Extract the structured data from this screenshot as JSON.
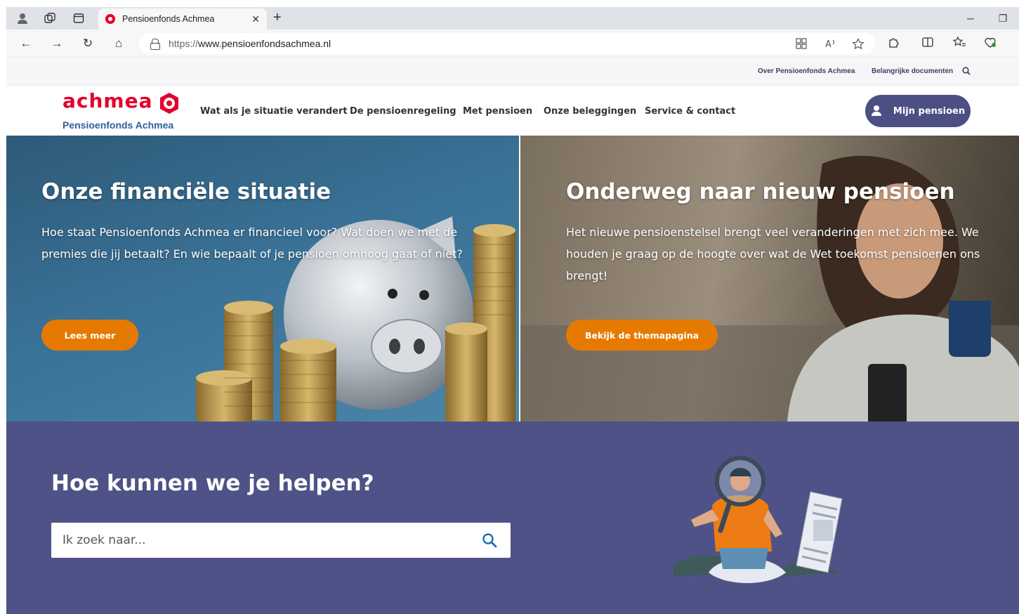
{
  "browser": {
    "tab_title": "Pensioenfonds Achmea",
    "tab_close": "✕",
    "new_tab": "+",
    "url_scheme": "https://",
    "url_host": "www.pensioenfondsachmea.nl",
    "win_minimize": "─",
    "win_restore": "❐",
    "nav_back": "←",
    "nav_forward": "→",
    "nav_reload": "↻",
    "nav_home": "⌂"
  },
  "utility": {
    "over": "Over Pensioenfonds Achmea",
    "docs": "Belangrijke documenten"
  },
  "brand": {
    "logo_word": "achmea",
    "logo_sub": "Pensioenfonds Achmea",
    "red": "#e4002b",
    "blue": "#2d5f9a",
    "purple": "#4f5286",
    "orange": "#e67a00"
  },
  "nav": {
    "items": [
      "Wat als je situatie verandert",
      "De pensioenregeling",
      "Met pensioen",
      "Onze beleggingen",
      "Service & contact"
    ],
    "mijn_pensioen": "Mijn pensioen"
  },
  "hero_left": {
    "title": "Onze financiële situatie",
    "text": "Hoe staat Pensioenfonds Achmea er financieel voor? Wat doen we met de premies die jij betaalt? En wie bepaalt of je pensioen omhoog gaat of niet?",
    "button": "Lees meer"
  },
  "hero_right": {
    "title": "Onderweg naar nieuw pensioen",
    "text": "Het nieuwe pensioenstelsel brengt veel veranderingen met zich mee. We houden je graag op de hoogte over wat de Wet toekomst pensioenen ons brengt!",
    "button": "Bekijk de themapagina"
  },
  "help": {
    "title": "Hoe kunnen we je helpen?",
    "placeholder": "Ik zoek naar..."
  }
}
